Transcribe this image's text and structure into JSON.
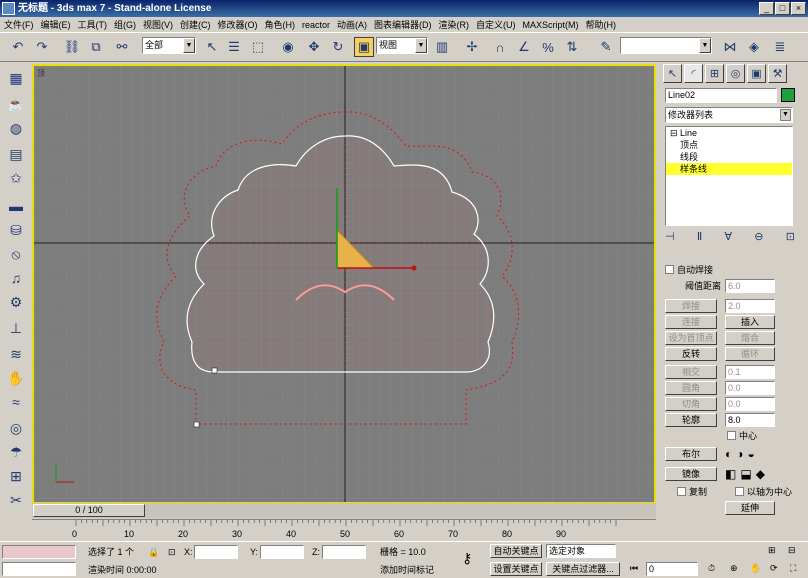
{
  "window": {
    "title": "无标题 - 3ds max 7 - Stand-alone License",
    "minimize": "_",
    "restore": "□",
    "close": "×"
  },
  "menu": [
    "文件(F)",
    "编辑(E)",
    "工具(T)",
    "组(G)",
    "视图(V)",
    "创建(C)",
    "修改器(O)",
    "角色(H)",
    "reactor",
    "动画(A)",
    "图表编辑器(D)",
    "渲染(R)",
    "自定义(U)",
    "MAXScript(M)",
    "帮助(H)"
  ],
  "toolbar": {
    "selection_filter": "全部",
    "coord_system": "视图"
  },
  "viewport": {
    "label": "顶"
  },
  "command_panel": {
    "object_name": "Line02",
    "object_color": "#1ea03c",
    "modifier_list": "修改器列表",
    "stack": {
      "root": "Line",
      "items": [
        "顶点",
        "线段",
        "样条线"
      ],
      "selected": "样条线"
    },
    "rollout": {
      "auto_weld": "自动焊接",
      "threshold_label": "阈值距离",
      "threshold_value": "6.0",
      "weld": "焊接",
      "weld_value": "2.0",
      "connect": "连接",
      "insert": "插入",
      "make_first": "设为首顶点",
      "fuse": "熔合",
      "reverse": "反转",
      "cycle": "循环",
      "cross_insert": "相交",
      "cross_value": "0.1",
      "fillet": "圆角",
      "fillet_value": "0.0",
      "chamfer": "切角",
      "chamfer_value": "0.0",
      "outline": "轮廓",
      "outline_value": "8.0",
      "center": "中心",
      "boolean": "布尔",
      "mirror": "镜像",
      "copy": "复制",
      "about_pivot": "以轴为中心",
      "extend": "延伸"
    }
  },
  "time": {
    "slider": "0 / 100",
    "ticks": [
      "0",
      "10",
      "20",
      "30",
      "40",
      "50",
      "60",
      "70",
      "80",
      "90"
    ]
  },
  "status": {
    "selected": "选择了 1 个",
    "x_label": "X:",
    "y_label": "Y:",
    "z_label": "Z:",
    "grid": "栅格 = 10.0",
    "auto_key": "自动关键点",
    "selected_obj": "选定对象",
    "render_time": "渲染时间  0:00:00",
    "add_time_tag": "添加时间标记",
    "set_key": "设置关键点",
    "key_filters": "关键点过滤器...",
    "frame": "0"
  }
}
